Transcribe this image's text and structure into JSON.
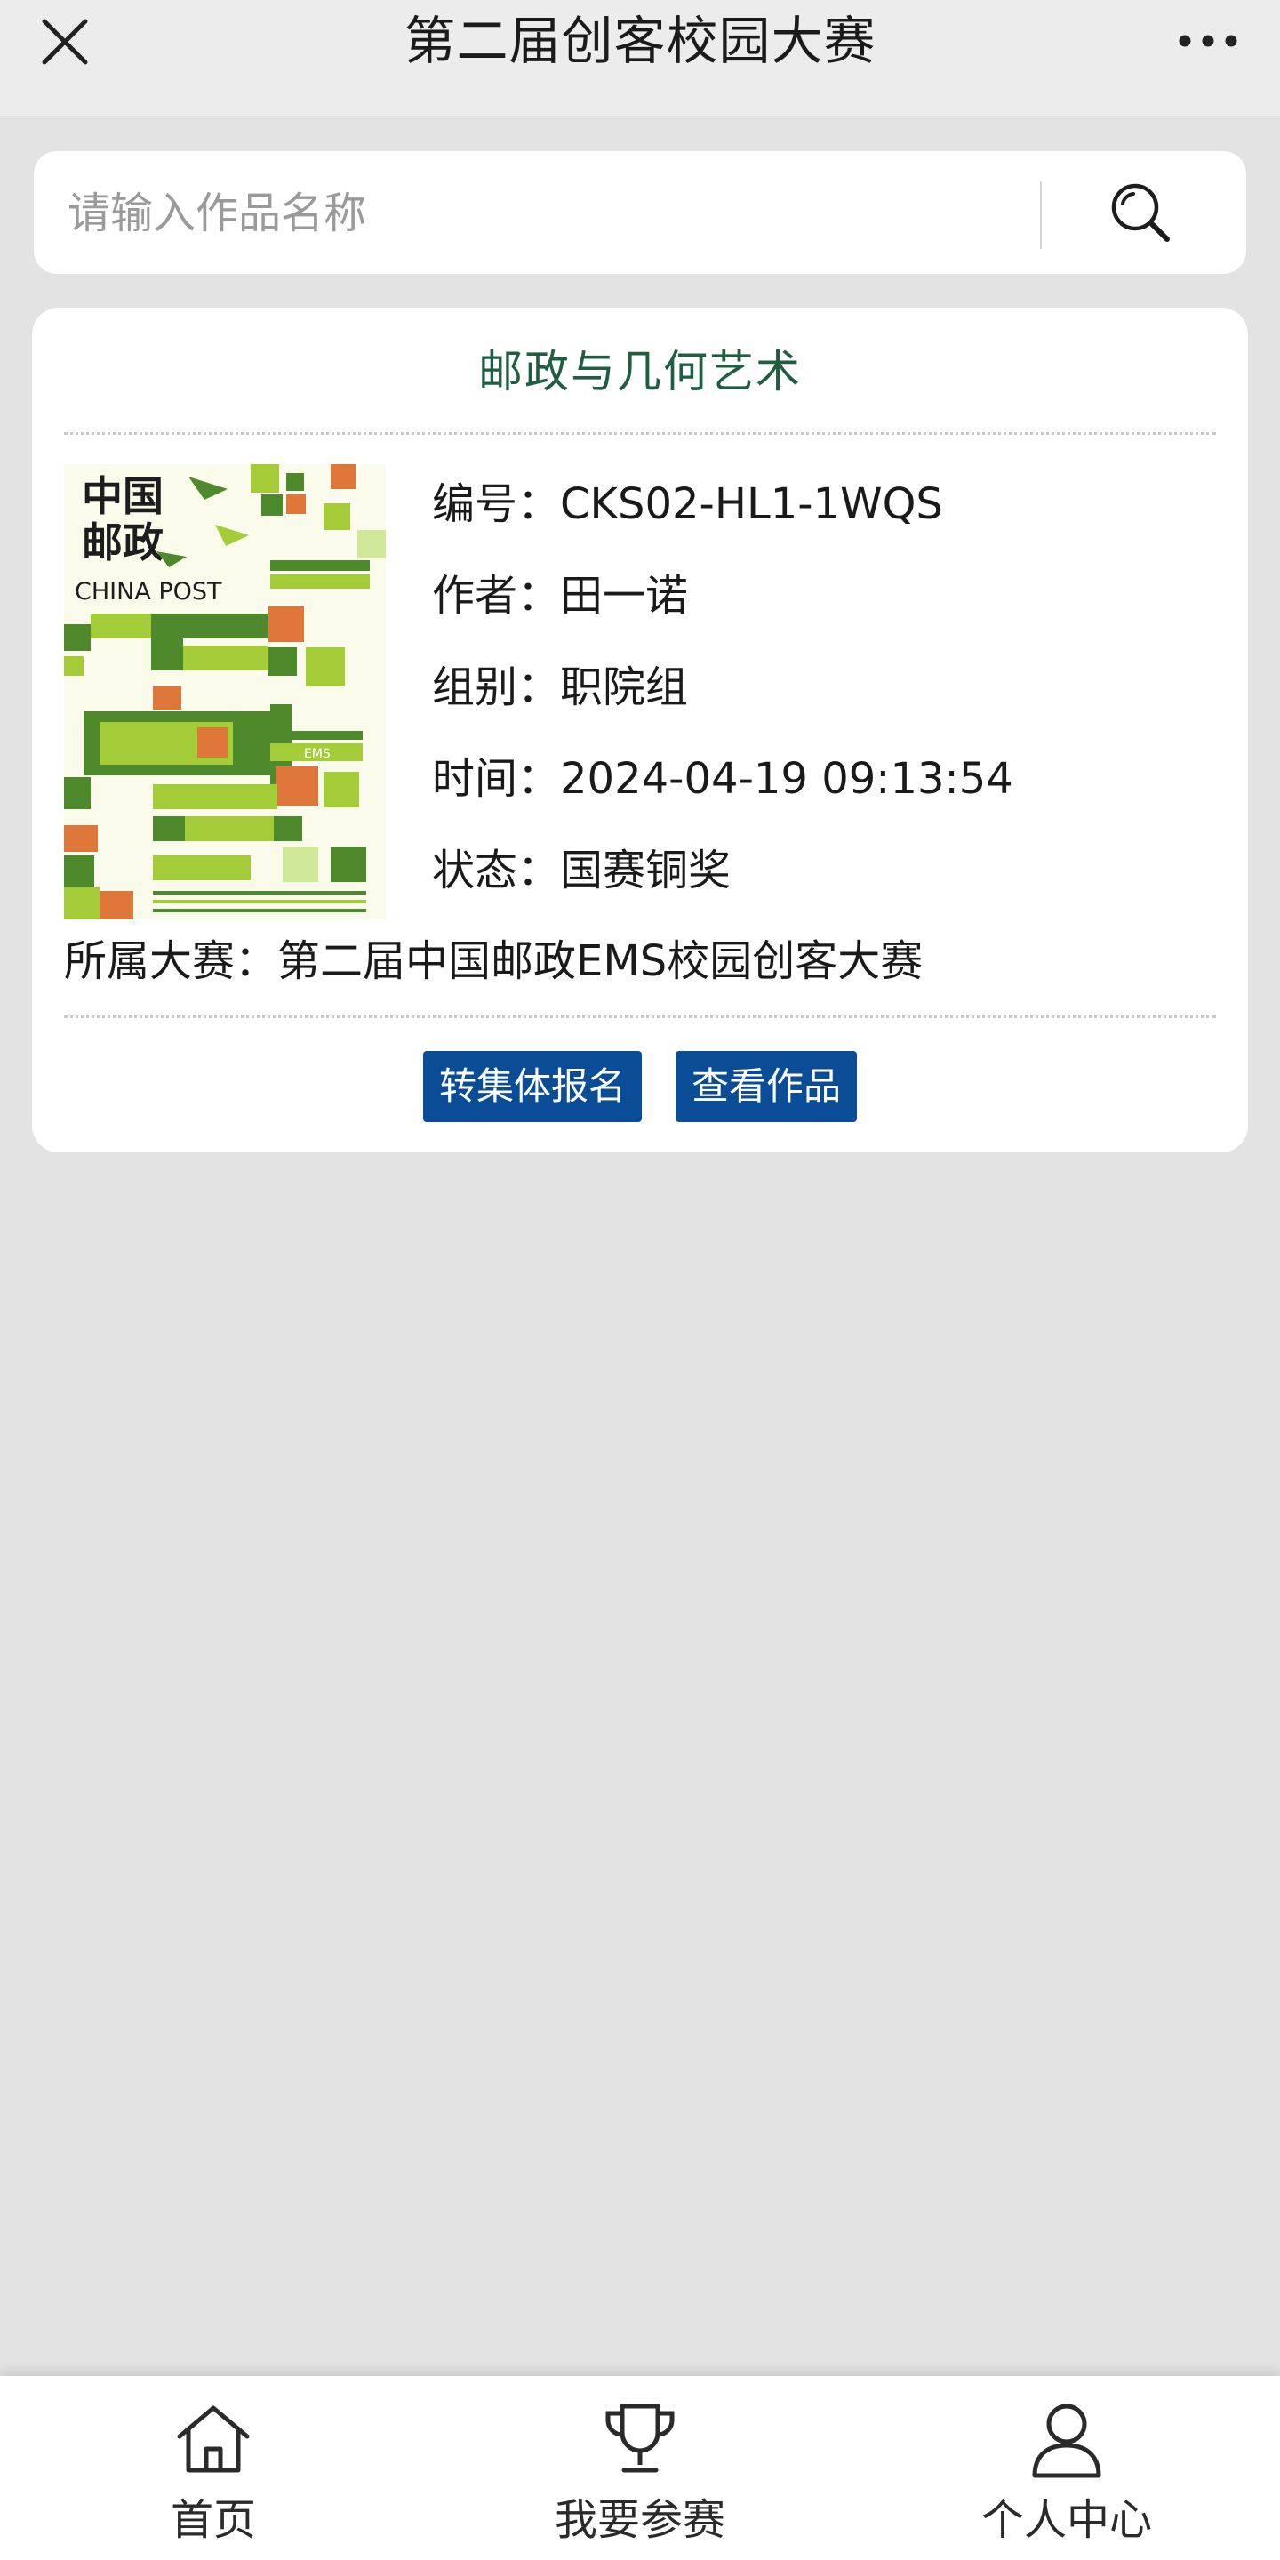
{
  "topbar": {
    "title": "第二届创客校园大赛",
    "close_icon": "close-icon",
    "more_icon": "more-dots-icon"
  },
  "search": {
    "placeholder": "请输入作品名称",
    "value": "",
    "icon": "search-icon"
  },
  "work": {
    "title": "邮政与几何艺术",
    "poster": {
      "icon": "china-post-poster-image",
      "logo_text_cn_line1": "中国",
      "logo_text_cn_line2": "邮政",
      "logo_text_en": "CHINA POST",
      "ems_text": "EMS"
    },
    "fields": [
      {
        "label": "编号：",
        "value": "CKS02-HL1-1WQS"
      },
      {
        "label": "作者：",
        "value": "田一诺"
      },
      {
        "label": "组别：",
        "value": "职院组"
      },
      {
        "label": "时间：",
        "value": "2024-04-19 09:13:54"
      },
      {
        "label": "状态：",
        "value": "国赛铜奖"
      }
    ],
    "contest": {
      "label": "所属大赛：",
      "value": "第二届中国邮政EMS校园创客大赛"
    },
    "actions": {
      "group_signup": "转集体报名",
      "view_work": "查看作品"
    }
  },
  "colors": {
    "page_bg": "#e3e3e3",
    "title_green": "#1f5e40",
    "button_blue": "#0a4d96",
    "poster_green": "#4e8a2c",
    "poster_lime": "#a4cc38",
    "poster_orange": "#e0773a"
  },
  "tabbar": {
    "items": [
      {
        "label": "首页",
        "icon": "home-icon"
      },
      {
        "label": "我要参赛",
        "icon": "trophy-icon"
      },
      {
        "label": "个人中心",
        "icon": "user-icon"
      }
    ]
  }
}
